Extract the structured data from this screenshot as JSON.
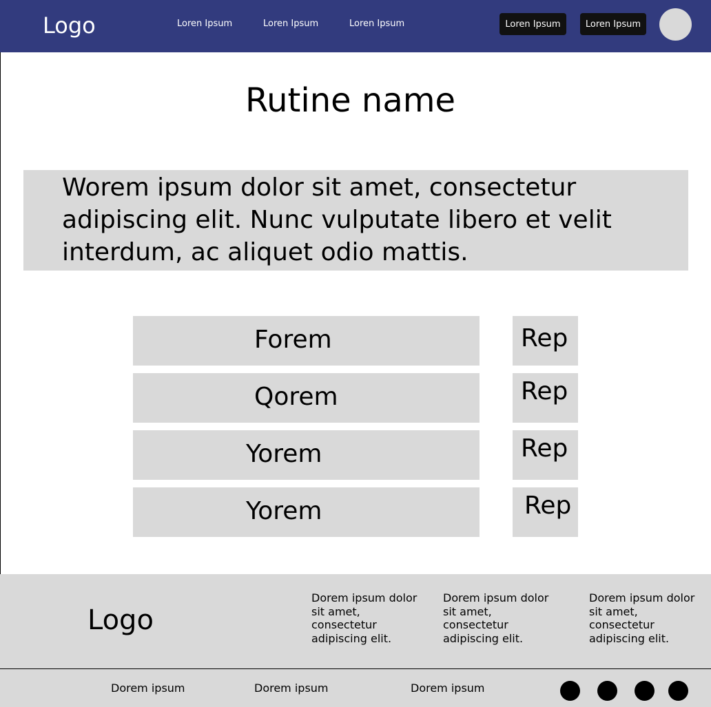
{
  "header": {
    "logo": "Logo",
    "nav": [
      "Loren Ipsum",
      "Loren Ipsum",
      "Loren Ipsum"
    ],
    "buttons": [
      "Loren Ipsum",
      "Loren Ipsum"
    ]
  },
  "main": {
    "title": "Rutine name",
    "description": "Worem ipsum dolor sit amet, consectetur adipiscing elit. Nunc vulputate libero et velit interdum, ac aliquet odio mattis.",
    "exercises": [
      {
        "name": "Forem",
        "rep": "Rep"
      },
      {
        "name": "Qorem",
        "rep": "Rep"
      },
      {
        "name": "Yorem",
        "rep": "Rep"
      },
      {
        "name": "Yorem",
        "rep": "Rep"
      }
    ]
  },
  "footer": {
    "logo": "Logo",
    "columns": [
      "Dorem ipsum dolor sit amet, consectetur adipiscing elit.",
      "Dorem ipsum dolor sit amet, consectetur adipiscing elit.",
      "Dorem ipsum dolor sit amet, consectetur adipiscing elit."
    ],
    "links": [
      "Dorem ipsum",
      "Dorem ipsum",
      "Dorem ipsum"
    ],
    "social_icons": [
      "social-icon",
      "social-icon",
      "social-icon",
      "social-icon"
    ]
  },
  "colors": {
    "header_bg": "#323b7e",
    "panel_gray": "#d9d9d9",
    "button_dark": "#111111"
  }
}
